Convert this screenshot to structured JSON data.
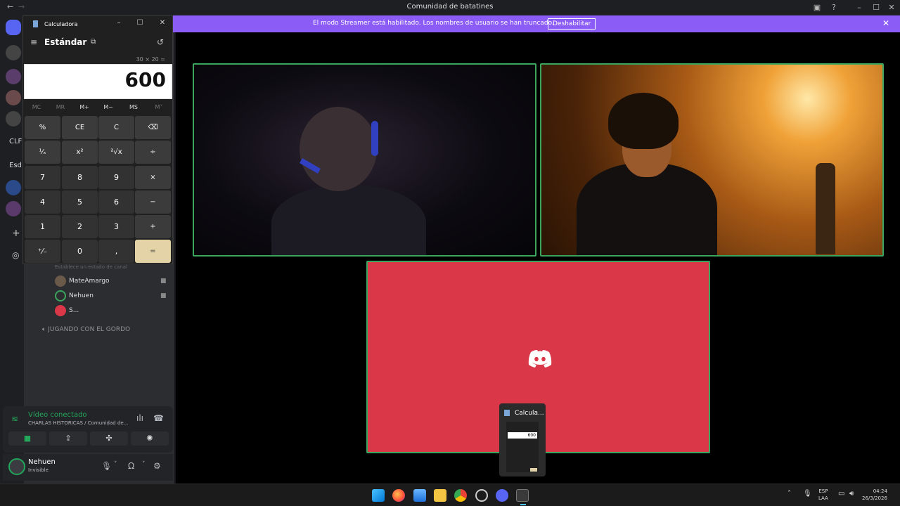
{
  "discord": {
    "window_title": "Comunidad de batatines",
    "banner": {
      "text": "El modo Streamer está habilitado. Los nombres de usuario se han truncado.",
      "button": "Deshabilitar"
    },
    "sidebar_fragments": [
      "CLF",
      "Esd"
    ],
    "members": [
      {
        "name": "MateAmargo",
        "camera": true
      },
      {
        "name": "Nehuen",
        "camera": true
      },
      {
        "name": "S...",
        "camera": false
      }
    ],
    "status_hint": "Establece un estado de canal",
    "other_channel": "JUGANDO CON EL GORDO",
    "voice": {
      "state": "Vídeo conectado",
      "location": "CHARLAS HISTORICAS / Comunidad de..."
    },
    "user": {
      "name": "Nehuen",
      "status": "Invisible"
    },
    "accent_colors": {
      "blurple": "#8b5cf6",
      "stage_tile": "#da3749",
      "speaking_border": "#3ba55d"
    }
  },
  "calculator": {
    "window_title": "Calculadora",
    "mode": "Estándar",
    "expression": "30 × 20 =",
    "display": "600",
    "memory_buttons": [
      "MC",
      "MR",
      "M+",
      "M−",
      "MS",
      "M˅"
    ],
    "keys": [
      [
        "%",
        "CE",
        "C",
        "⌫"
      ],
      [
        "¹⁄ₓ",
        "x²",
        "²√x",
        "÷"
      ],
      [
        "7",
        "8",
        "9",
        "×"
      ],
      [
        "4",
        "5",
        "6",
        "−"
      ],
      [
        "1",
        "2",
        "3",
        "+"
      ],
      [
        "⁺⁄₋",
        "0",
        ",",
        "="
      ]
    ]
  },
  "thumbnail": {
    "label": "Calcula...",
    "display": "600"
  },
  "taskbar": {
    "lang_top": "ESP",
    "lang_bottom": "LAA",
    "time": "04:24",
    "date": "26/3/2026"
  }
}
